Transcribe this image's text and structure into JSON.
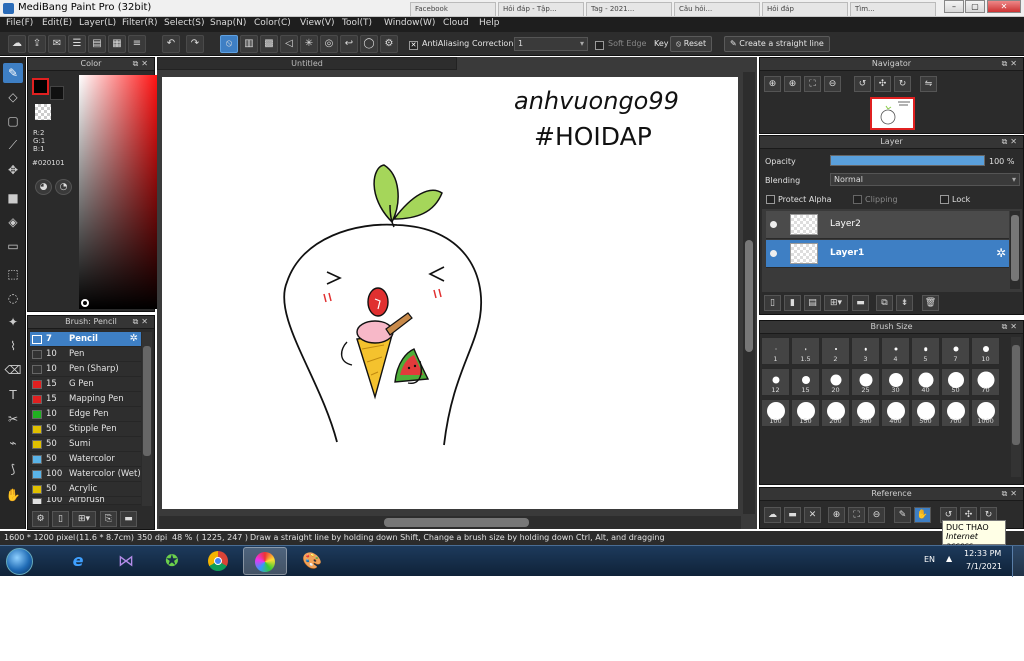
{
  "window": {
    "title": "MediBang Paint Pro (32bit)",
    "controls": [
      "–",
      "▢",
      "✕"
    ],
    "bg_tabs": [
      "Facebook",
      "Hỏi đáp - Tập...",
      "Tag - 2021...",
      "Câu hỏi...",
      "Hỏi đáp",
      "Tìm..."
    ]
  },
  "menu": [
    "File(F)",
    "Edit(E)",
    "Layer(L)",
    "Filter(R)",
    "Select(S)",
    "Snap(N)",
    "Color(C)",
    "View(V)",
    "Tool(T)",
    "Window(W)",
    "Cloud",
    "Help"
  ],
  "toolbar": {
    "antialiasing_label": "AntiAliasing",
    "correction_label": "Correction",
    "correction_value": "1",
    "soft_edge_label": "Soft Edge",
    "key_label": "Key",
    "reset_label": "Reset",
    "straight_line_label": "Create a straight line"
  },
  "color_panel": {
    "title": "Color",
    "r": "R:2",
    "g": "G:1",
    "b": "B:1",
    "hex": "#020101",
    "fg": "#020101"
  },
  "brush_panel": {
    "title": "Brush: Pencil",
    "items": [
      {
        "size": "7",
        "name": "Pencil",
        "color": "#3e7fc4"
      },
      {
        "size": "10",
        "name": "Pen",
        "color": "#333333"
      },
      {
        "size": "10",
        "name": "Pen (Sharp)",
        "color": "#333333"
      },
      {
        "size": "15",
        "name": "G Pen",
        "color": "#e02020"
      },
      {
        "size": "15",
        "name": "Mapping Pen",
        "color": "#e02020"
      },
      {
        "size": "10",
        "name": "Edge Pen",
        "color": "#20b020"
      },
      {
        "size": "50",
        "name": "Stipple Pen",
        "color": "#e0c000"
      },
      {
        "size": "50",
        "name": "Sumi",
        "color": "#e0c000"
      },
      {
        "size": "50",
        "name": "Watercolor",
        "color": "#5ab4e8"
      },
      {
        "size": "100",
        "name": "Watercolor (Wet)",
        "color": "#5ab4e8"
      },
      {
        "size": "50",
        "name": "Acrylic",
        "color": "#e0c000"
      },
      {
        "size": "100",
        "name": "Airbrush",
        "color": "#e0e0e0"
      }
    ]
  },
  "canvas": {
    "doc_title": "Untitled",
    "handwriting_line1": "anhvuongo99",
    "handwriting_line2": "#HOIDAP"
  },
  "navigator": {
    "title": "Navigator"
  },
  "layer_panel": {
    "title": "Layer",
    "opacity_label": "Opacity",
    "opacity_value": "100 %",
    "opacity_level": 1.0,
    "blending_label": "Blending",
    "blending_value": "Normal",
    "protect_alpha": "Protect Alpha",
    "clipping": "Clipping",
    "lock": "Lock",
    "layers": [
      {
        "name": "Layer2",
        "selected": false
      },
      {
        "name": "Layer1",
        "selected": true
      }
    ]
  },
  "brush_size": {
    "title": "Brush Size",
    "sizes": [
      "1",
      "1.5",
      "2",
      "3",
      "4",
      "5",
      "7",
      "10",
      "12",
      "15",
      "20",
      "25",
      "30",
      "40",
      "50",
      "70",
      "100",
      "150",
      "200",
      "300",
      "400",
      "500",
      "700",
      "1000"
    ]
  },
  "reference": {
    "title": "Reference"
  },
  "status": {
    "dims": "1600 * 1200 pixel",
    "size_cm": "(11.6 * 8.7cm)",
    "dpi": "350 dpi",
    "zoom": "48 %",
    "coords": "( 1225, 247 )",
    "hint": "Draw a straight line by holding down Shift, Change a brush size by holding down Ctrl, Alt, and dragging"
  },
  "taskbar": {
    "tooltip_title": "DUC THAO",
    "tooltip_sub": "Internet access",
    "lang": "EN",
    "time": "12:33 PM",
    "date": "7/1/2021"
  }
}
